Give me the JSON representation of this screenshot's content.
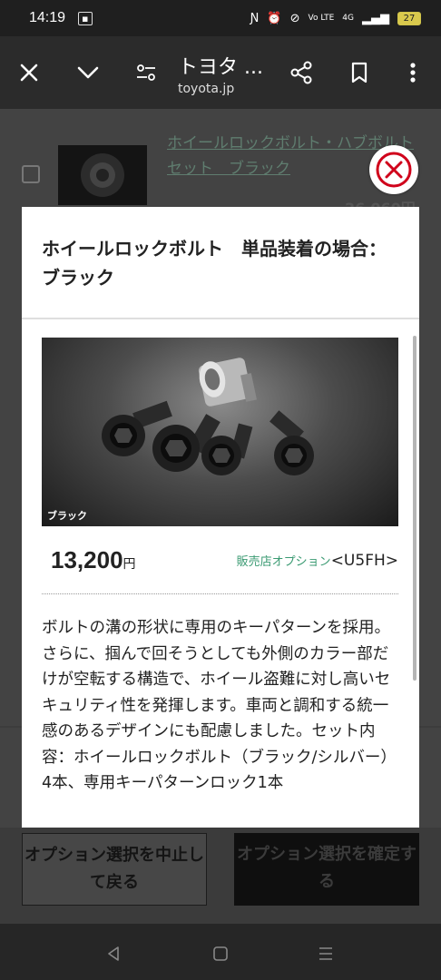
{
  "status_bar": {
    "time": "14:19",
    "left_badge": "",
    "network": "4G",
    "volte": "Vo LTE",
    "battery": "27"
  },
  "browser": {
    "title": "トヨタ ...",
    "url": "toyota.jp"
  },
  "background_item": {
    "link_text": "ホイールロックボルト・ハブボルトセット　ブラック",
    "price_partial": "26,060円"
  },
  "modal": {
    "title": "ホイールロックボルト　単品装着の場合：ブラック",
    "image_label": "ブラック",
    "price_value": "13,200",
    "price_unit": "円",
    "option_label": "販売店オプション",
    "option_code": "<U5FH>",
    "description": "ボルトの溝の形状に専用のキーパターンを採用。さらに、掴んで回そうとしても外側のカラー部だけが空転する構造で、ホイール盗難に対し高いセキュリティ性を発揮します。車両と調和する統一感のあるデザインにも配慮しました。セット内容：ホイールロックボルト（ブラック/シルバー）4本、専用キーパターンロック1本"
  },
  "footer": {
    "cancel_label": "オプション選択を中止して戻る",
    "confirm_label": "オプション選択を確定する"
  },
  "colors": {
    "accent_red": "#d0021b",
    "option_green": "#3a9a72"
  },
  "icons": [
    "close-icon",
    "chevron-down-icon",
    "page-settings-icon",
    "share-icon",
    "bookmark-icon",
    "more-vert-icon",
    "back-nav-icon",
    "home-nav-icon",
    "recents-nav-icon"
  ]
}
